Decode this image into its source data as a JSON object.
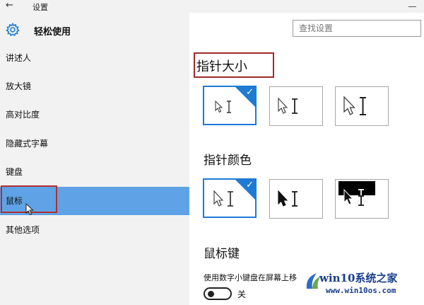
{
  "window": {
    "title": "设置"
  },
  "header": {
    "section_title": "轻松使用"
  },
  "search": {
    "placeholder": "查找设置"
  },
  "sidebar": {
    "items": [
      {
        "label": "讲述人"
      },
      {
        "label": "放大镜"
      },
      {
        "label": "高对比度"
      },
      {
        "label": "隐藏式字幕"
      },
      {
        "label": "键盘"
      },
      {
        "label": "鼠标"
      },
      {
        "label": "其他选项"
      }
    ],
    "selected_index": 5
  },
  "main": {
    "pointer_size": {
      "title": "指针大小",
      "selected_index": 0
    },
    "pointer_color": {
      "title": "指针颜色",
      "selected_index": 0
    },
    "mouse_keys": {
      "title": "鼠标键",
      "description": "使用数字小键盘在屏幕上移",
      "toggle_label": "关",
      "toggle_on": false
    }
  },
  "colors": {
    "accent": "#1e7ad3",
    "selected_nav": "#5fa3e6",
    "highlight_red": "#b03030"
  },
  "watermark": {
    "title": "win10系统之家",
    "url": "www.win10os.com"
  }
}
